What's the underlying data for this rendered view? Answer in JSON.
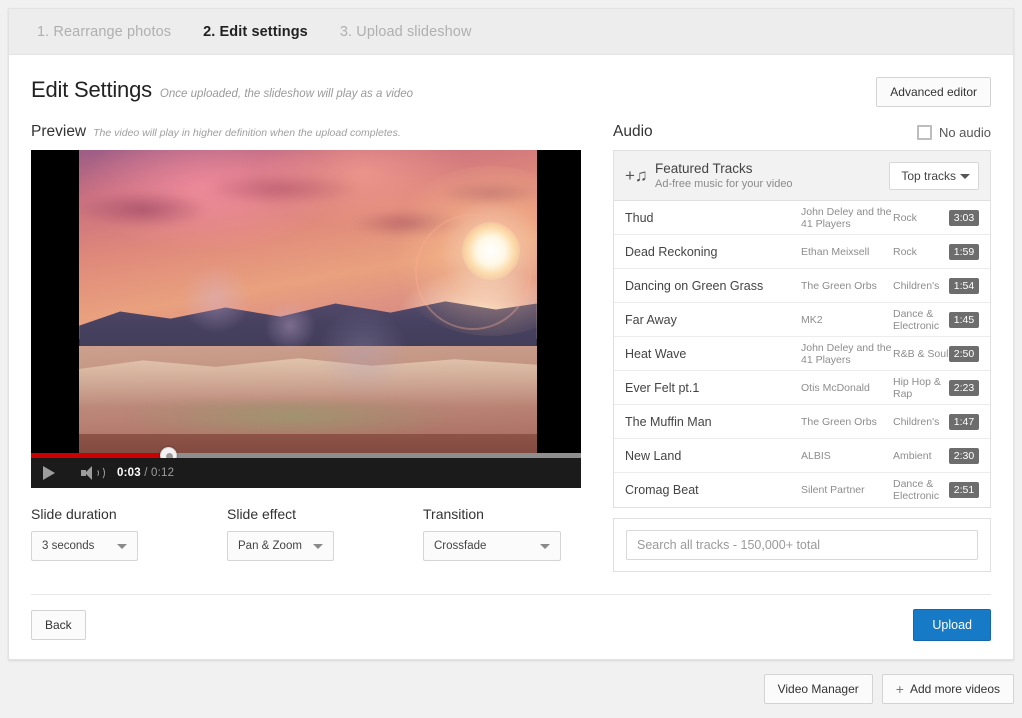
{
  "steps": [
    {
      "label": "1. Rearrange photos",
      "active": false
    },
    {
      "label": "2. Edit settings",
      "active": true
    },
    {
      "label": "3. Upload slideshow",
      "active": false
    }
  ],
  "header": {
    "title": "Edit Settings",
    "subtitle": "Once uploaded, the slideshow will play as a video",
    "advanced_editor_label": "Advanced editor"
  },
  "preview": {
    "title": "Preview",
    "note": "The video will play in higher definition when the upload completes.",
    "current_time": "0:03",
    "time_separator": "/",
    "total_time": "0:12",
    "progress_percent": 25,
    "play_icon": "play-icon",
    "volume_icon": "volume-icon"
  },
  "settings": {
    "slide_duration": {
      "label": "Slide duration",
      "value": "3 seconds"
    },
    "slide_effect": {
      "label": "Slide effect",
      "value": "Pan & Zoom"
    },
    "transition": {
      "label": "Transition",
      "value": "Crossfade"
    }
  },
  "audio": {
    "title": "Audio",
    "no_audio_label": "No audio",
    "no_audio_checked": false,
    "featured": {
      "title": "Featured Tracks",
      "subtitle": "Ad-free music for your video",
      "icon": "add-music-note-icon",
      "sort_label": "Top tracks"
    },
    "tracks": [
      {
        "title": "Thud",
        "artist": "John Deley and the 41 Players",
        "genre": "Rock",
        "duration": "3:03"
      },
      {
        "title": "Dead Reckoning",
        "artist": "Ethan Meixsell",
        "genre": "Rock",
        "duration": "1:59"
      },
      {
        "title": "Dancing on Green Grass",
        "artist": "The Green Orbs",
        "genre": "Children's",
        "duration": "1:54"
      },
      {
        "title": "Far Away",
        "artist": "MK2",
        "genre": "Dance & Electronic",
        "duration": "1:45"
      },
      {
        "title": "Heat Wave",
        "artist": "John Deley and the 41 Players",
        "genre": "R&B & Soul",
        "duration": "2:50"
      },
      {
        "title": "Ever Felt pt.1",
        "artist": "Otis McDonald",
        "genre": "Hip Hop & Rap",
        "duration": "2:23"
      },
      {
        "title": "The Muffin Man",
        "artist": "The Green Orbs",
        "genre": "Children's",
        "duration": "1:47"
      },
      {
        "title": "New Land",
        "artist": "ALBIS",
        "genre": "Ambient",
        "duration": "2:30"
      },
      {
        "title": "Cromag Beat",
        "artist": "Silent Partner",
        "genre": "Dance & Electronic",
        "duration": "2:51"
      }
    ],
    "search_placeholder": "Search all tracks - 150,000+ total"
  },
  "actions": {
    "back_label": "Back",
    "upload_label": "Upload"
  },
  "footer": {
    "video_manager_label": "Video Manager",
    "add_more_videos_label": "Add more videos",
    "add_icon": "plus-icon"
  },
  "colors": {
    "accent_blue": "#167ac6",
    "progress_red": "#cc0000",
    "tab_bar_bg": "#ededed"
  }
}
